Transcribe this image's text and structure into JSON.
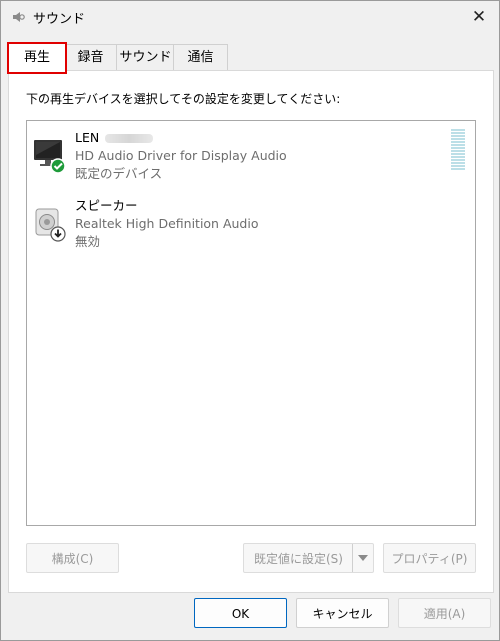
{
  "window": {
    "title": "サウンド",
    "close_glyph": "✕"
  },
  "tabs": [
    {
      "label": "再生",
      "active": true
    },
    {
      "label": "録音",
      "active": false
    },
    {
      "label": "サウンド",
      "active": false
    },
    {
      "label": "通信",
      "active": false
    }
  ],
  "instruction": "下の再生デバイスを選択してその設定を変更してください:",
  "devices": [
    {
      "name": "LEN",
      "name_redacted": true,
      "driver": "HD Audio Driver for Display Audio",
      "status": "既定のデバイス",
      "icon": "monitor-icon",
      "badge": "default-check-icon"
    },
    {
      "name": "スピーカー",
      "name_redacted": false,
      "driver": "Realtek High Definition Audio",
      "status": "無効",
      "icon": "speaker-icon",
      "badge": "disabled-arrow-icon"
    }
  ],
  "buttons": {
    "configure": "構成(C)",
    "set_default": "既定値に設定(S)",
    "properties": "プロパティ(P)",
    "ok": "OK",
    "cancel": "キャンセル",
    "apply": "適用(A)"
  },
  "colors": {
    "tab_highlight": "#e00000",
    "check_badge": "#1e9b3a",
    "meter": "#bcdfe7",
    "primary_border": "#0067c0"
  }
}
